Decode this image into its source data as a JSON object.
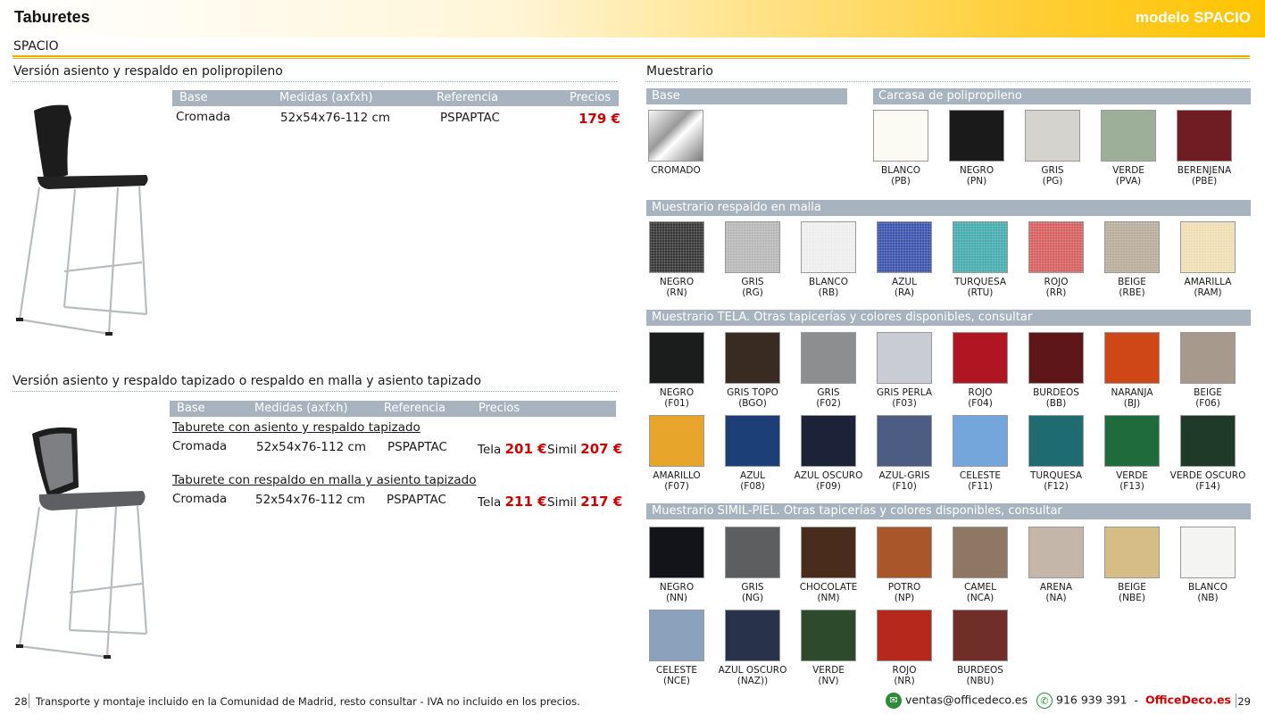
{
  "header": {
    "title": "Taburetes",
    "model": "modelo SPACIO"
  },
  "subtitle": "SPACIO",
  "section1": {
    "title": "Versión asiento y respaldo en polipropileno",
    "headers": [
      "Base",
      "Medidas (axfxh)",
      "Referencia",
      "Precios"
    ],
    "row": {
      "base": "Cromada",
      "measures": "52x54x76-112 cm",
      "ref": "PSPAPTAC",
      "price": "179 €"
    }
  },
  "section2": {
    "title": "Versión asiento y respaldo tapizado o respaldo en malla y asiento tapizado",
    "headers": [
      "Base",
      "Medidas (axfxh)",
      "Referencia",
      "Precios"
    ],
    "groups": [
      {
        "name": "Taburete con asiento y respaldo tapizado",
        "base": "Cromada",
        "measures": "52x54x76-112 cm",
        "ref": "PSPAPTAC",
        "tela_label": "Tela",
        "tela_price": "201 €",
        "simil_label": "Simil",
        "simil_price": "207 €"
      },
      {
        "name": "Taburete con respaldo en malla y asiento tapizado",
        "base": "Cromada",
        "measures": "52x54x76-112 cm",
        "ref": "PSPAPTAC",
        "tela_label": "Tela",
        "tela_price": "211 €",
        "simil_label": "Simil",
        "simil_price": "217 €"
      }
    ]
  },
  "muestrario": {
    "title": "Muestrario",
    "base_title": "Base",
    "base": [
      {
        "name": "CROMADO",
        "code": "",
        "color": "#c8c8c8"
      }
    ],
    "carcasa_title": "Carcasa de polipropileno",
    "carcasa": [
      {
        "name": "BLANCO",
        "code": "(PB)",
        "color": "#fbfbf3"
      },
      {
        "name": "NEGRO",
        "code": "(PN)",
        "color": "#1a1a1a"
      },
      {
        "name": "GRIS",
        "code": "(PG)",
        "color": "#d5d3cd"
      },
      {
        "name": "VERDE",
        "code": "(PVA)",
        "color": "#9eaf99"
      },
      {
        "name": "BERENJENA",
        "code": "(PBE)",
        "color": "#6e1e22"
      }
    ],
    "malla_title": "Muestrario respaldo en malla",
    "malla": [
      {
        "name": "NEGRO",
        "code": "(RN)",
        "color": "#2b2b2b"
      },
      {
        "name": "GRIS",
        "code": "(RG)",
        "color": "#b4b4b4"
      },
      {
        "name": "BLANCO",
        "code": "(RB)",
        "color": "#ececec"
      },
      {
        "name": "AZUL",
        "code": "(RA)",
        "color": "#2f4aa6"
      },
      {
        "name": "TURQUESA",
        "code": "(RTU)",
        "color": "#3aa7a9"
      },
      {
        "name": "ROJO",
        "code": "(RR)",
        "color": "#d45656"
      },
      {
        "name": "BEIGE",
        "code": "(RBE)",
        "color": "#b5a693"
      },
      {
        "name": "AMARILLA",
        "code": "(RAM)",
        "color": "#eedcae"
      }
    ],
    "tela_title": "Muestrario TELA. Otras tapicerías y colores disponibles, consultar",
    "tela": [
      {
        "name": "NEGRO",
        "code": "(F01)",
        "color": "#1b1c1c"
      },
      {
        "name": "GRIS TOPO",
        "code": "(BGO)",
        "color": "#3a2b22"
      },
      {
        "name": "GRIS",
        "code": "(F02)",
        "color": "#8d8e90"
      },
      {
        "name": "GRIS PERLA",
        "code": "(F03)",
        "color": "#c9ccd2"
      },
      {
        "name": "ROJO",
        "code": "(F04)",
        "color": "#b01622"
      },
      {
        "name": "BURDEOS",
        "code": "(BB)",
        "color": "#5e1619"
      },
      {
        "name": "NARANJA",
        "code": "(BJ)",
        "color": "#cf4716"
      },
      {
        "name": "BEIGE",
        "code": "(F06)",
        "color": "#a79a8c"
      },
      {
        "name": "AMARILLO",
        "code": "(F07)",
        "color": "#e8a52c"
      },
      {
        "name": "AZUL",
        "code": "(F08)",
        "color": "#1d3f78"
      },
      {
        "name": "AZUL OSCURO",
        "code": "(F09)",
        "color": "#1c2338"
      },
      {
        "name": "AZUL-GRIS",
        "code": "(F10)",
        "color": "#4c5c83"
      },
      {
        "name": "CELESTE",
        "code": "(F11)",
        "color": "#74a6dc"
      },
      {
        "name": "TURQUESA",
        "code": "(F12)",
        "color": "#1f6b72"
      },
      {
        "name": "VERDE",
        "code": "(F13)",
        "color": "#1f6b3c"
      },
      {
        "name": "VERDE OSCURO",
        "code": "(F14)",
        "color": "#1f3a29"
      }
    ],
    "simil_title": "Muestrario SIMIL-PIEL. Otras tapicerías y colores disponibles, consultar",
    "simil": [
      {
        "name": "NEGRO",
        "code": "(NN)",
        "color": "#121419"
      },
      {
        "name": "GRIS",
        "code": "(NG)",
        "color": "#5c5e5f"
      },
      {
        "name": "CHOCOLATE",
        "code": "(NM)",
        "color": "#4a2c1c"
      },
      {
        "name": "POTRO",
        "code": "(NP)",
        "color": "#a9562a"
      },
      {
        "name": "CAMEL",
        "code": "(NCA)",
        "color": "#8e7864"
      },
      {
        "name": "ARENA",
        "code": "(NA)",
        "color": "#c4b6a8"
      },
      {
        "name": "BEIGE",
        "code": "(NBE)",
        "color": "#d5bd85"
      },
      {
        "name": "BLANCO",
        "code": "(NB)",
        "color": "#f4f4f2"
      },
      {
        "name": "CELESTE",
        "code": "(NCE)",
        "color": "#8aa2bc"
      },
      {
        "name": "AZUL OSCURO",
        "code": "(NAZ))",
        "color": "#28324a"
      },
      {
        "name": "VERDE",
        "code": "(NV)",
        "color": "#2d4a2c"
      },
      {
        "name": "ROJO",
        "code": "(NR)",
        "color": "#b7281c"
      },
      {
        "name": "BURDEOS",
        "code": "(NBU)",
        "color": "#6f2e28"
      }
    ]
  },
  "footer": {
    "page_left": "28",
    "text": "Transporte y montaje incluido en la Comunidad de Madrid, resto consultar - IVA no incluido en los precios.",
    "email": "ventas@officedeco.es",
    "phone": "916 939 391",
    "dash": "-",
    "brand": "OfficeDeco.es",
    "page_right": "29"
  }
}
